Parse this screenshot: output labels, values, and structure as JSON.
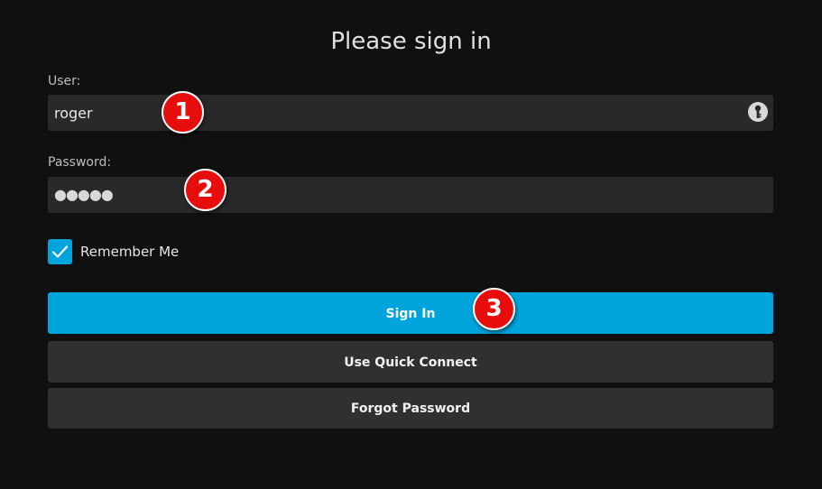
{
  "login": {
    "title": "Please sign in",
    "user_label": "User:",
    "user_value": "roger",
    "password_label": "Password:",
    "password_value": "●●●●●",
    "remember_label": "Remember Me",
    "remember_checked": true,
    "password_manager_icon": "key-icon"
  },
  "buttons": {
    "sign_in": "Sign In",
    "quick_connect": "Use Quick Connect",
    "forgot_password": "Forgot Password"
  },
  "callouts": {
    "one": "1",
    "two": "2",
    "three": "3"
  },
  "colors": {
    "accent": "#00a4dc",
    "background": "#101010",
    "input_background": "#292929",
    "secondary_button": "#303030",
    "callout": "#e80d0d"
  }
}
